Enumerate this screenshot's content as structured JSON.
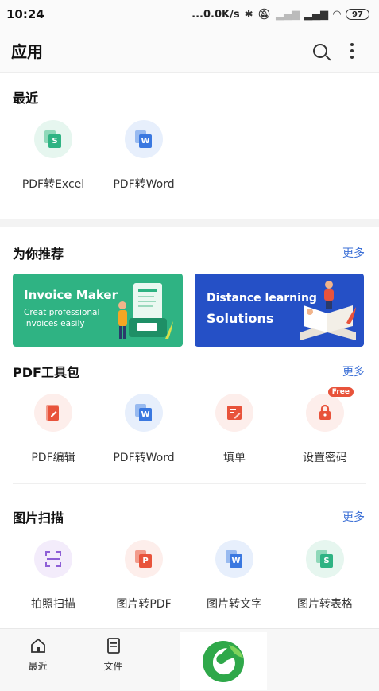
{
  "status_bar": {
    "time": "10:24",
    "network_speed": "...0.0K/s",
    "battery": "97",
    "icons": [
      "bluetooth-icon",
      "mute-icon",
      "signal-icon",
      "signal-icon",
      "wifi-icon",
      "battery-icon"
    ]
  },
  "app_bar": {
    "title": "应用",
    "icons": [
      "search-icon",
      "more-vertical-icon"
    ]
  },
  "recent": {
    "title": "最近",
    "items": [
      {
        "label": "PDF转Excel",
        "icon": "pdf-to-excel-icon",
        "color": "#2fb383",
        "letter": "S"
      },
      {
        "label": "PDF转Word",
        "icon": "pdf-to-word-icon",
        "color": "#3a78e0",
        "letter": "W"
      }
    ]
  },
  "recommend": {
    "title": "为你推荐",
    "more": "更多",
    "banners": [
      {
        "title": "Invoice Maker",
        "subtitle_line1": "Creat professional",
        "subtitle_line2": "invoices easily",
        "color": "#2fb383"
      },
      {
        "title_line1": "Distance learning",
        "title_line2": "Solutions",
        "color": "#2550c6"
      }
    ]
  },
  "pdf_toolkit": {
    "title": "PDF工具包",
    "more": "更多",
    "items": [
      {
        "label": "PDF编辑",
        "icon": "pdf-edit-icon",
        "color": "#e8533b"
      },
      {
        "label": "PDF转Word",
        "icon": "pdf-to-word-icon",
        "color": "#3a78e0",
        "letter": "W"
      },
      {
        "label": "填单",
        "icon": "fill-form-icon",
        "color": "#e8533b"
      },
      {
        "label": "设置密码",
        "icon": "lock-icon",
        "color": "#e8533b",
        "badge": "Free"
      }
    ]
  },
  "image_scan": {
    "title": "图片扫描",
    "more": "更多",
    "items": [
      {
        "label": "拍照扫描",
        "icon": "scan-icon",
        "color": "#8e5fd6"
      },
      {
        "label": "图片转PDF",
        "icon": "image-to-pdf-icon",
        "color": "#e8533b",
        "letter": "P"
      },
      {
        "label": "图片转文字",
        "icon": "image-to-text-icon",
        "color": "#3a78e0",
        "letter": "W"
      },
      {
        "label": "图片转表格",
        "icon": "image-to-table-icon",
        "color": "#2fb383",
        "letter": "S"
      }
    ]
  },
  "bottom_nav": {
    "items": [
      {
        "label": "最近",
        "icon": "home-icon"
      },
      {
        "label": "文件",
        "icon": "file-icon"
      }
    ]
  }
}
